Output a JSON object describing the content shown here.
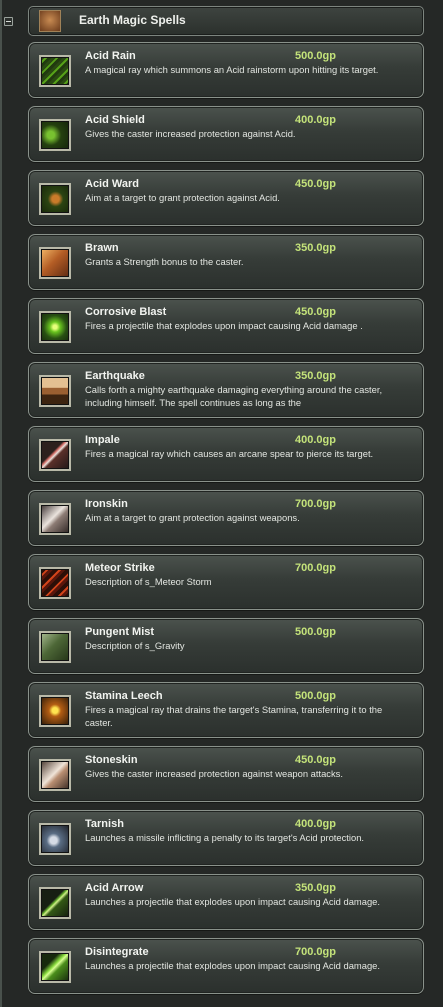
{
  "header": {
    "title": "Earth Magic Spells",
    "icon": "earth-spellbook-icon"
  },
  "spells": [
    {
      "name": "Acid Rain",
      "price": "500.0gp",
      "description": "A magical ray which summons an Acid rainstorm upon hitting its target.",
      "icon": "acid-rain-icon"
    },
    {
      "name": "Acid Shield",
      "price": "400.0gp",
      "description": "Gives the caster increased protection against Acid.",
      "icon": "acid-shield-icon"
    },
    {
      "name": "Acid Ward",
      "price": "450.0gp",
      "description": "Aim at a target to grant protection against Acid.",
      "icon": "acid-ward-icon"
    },
    {
      "name": "Brawn",
      "price": "350.0gp",
      "description": "Grants a Strength bonus to the caster.",
      "icon": "brawn-icon"
    },
    {
      "name": "Corrosive Blast",
      "price": "450.0gp",
      "description": "Fires a projectile that explodes upon impact causing Acid damage .",
      "icon": "corrosive-blast-icon"
    },
    {
      "name": "Earthquake",
      "price": "350.0gp",
      "description": "Calls forth a mighty earthquake damaging everything around the caster, including himself. The spell continues as long as the",
      "icon": "earthquake-icon"
    },
    {
      "name": "Impale",
      "price": "400.0gp",
      "description": "Fires a magical ray which causes an arcane spear to pierce its target.",
      "icon": "impale-icon"
    },
    {
      "name": "Ironskin",
      "price": "700.0gp",
      "description": "Aim at a target to grant protection against weapons.",
      "icon": "ironskin-icon"
    },
    {
      "name": "Meteor Strike",
      "price": "700.0gp",
      "description": "Description of s_Meteor Storm",
      "icon": "meteor-strike-icon"
    },
    {
      "name": "Pungent Mist",
      "price": "500.0gp",
      "description": "Description of s_Gravity",
      "icon": "pungent-mist-icon"
    },
    {
      "name": "Stamina Leech",
      "price": "500.0gp",
      "description": "Fires a magical ray that drains the target's Stamina, transferring it to the caster.",
      "icon": "stamina-leech-icon"
    },
    {
      "name": "Stoneskin",
      "price": "450.0gp",
      "description": "Gives the caster increased protection against weapon attacks.",
      "icon": "stoneskin-icon"
    },
    {
      "name": "Tarnish",
      "price": "400.0gp",
      "description": "Launches a missile inflicting a penalty to its target's Acid protection.",
      "icon": "tarnish-icon"
    },
    {
      "name": "Acid Arrow",
      "price": "350.0gp",
      "description": "Launches a projectile that explodes upon impact causing Acid damage.",
      "icon": "acid-arrow-icon"
    },
    {
      "name": "Disintegrate",
      "price": "700.0gp",
      "description": "Launches a projectile that explodes upon impact causing Acid damage.",
      "icon": "disintegrate-icon"
    }
  ],
  "colors": {
    "background": "#252826",
    "card_border": "#8a928b",
    "name_text": "#f2f4f0",
    "price_text": "#c4e37a",
    "description_text": "#e3e6e1"
  }
}
